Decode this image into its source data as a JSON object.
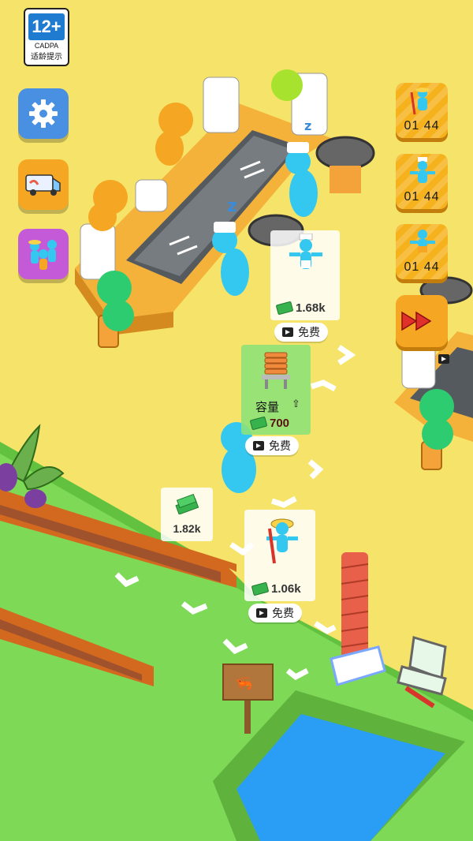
{
  "age_rating": {
    "badge": "12+",
    "org": "CADPA",
    "label": "适龄提示"
  },
  "hud": {
    "settings_icon": "gear-icon",
    "delivery_icon": "van-icon",
    "staff_icon": "workers-icon",
    "speedup_icon": "fast-forward-icon"
  },
  "worker_timers": [
    {
      "role": "fisher",
      "time": "01  44"
    },
    {
      "role": "chef",
      "time": "01  44"
    },
    {
      "role": "helper",
      "time": "01  44"
    }
  ],
  "upgrades": {
    "hire_chef": {
      "price": "1.68k",
      "free_label": "免费"
    },
    "capacity": {
      "label": "容量",
      "price": "700",
      "free_label": "免费"
    },
    "cash_pickup": {
      "price": "1.82k"
    },
    "hire_fisher": {
      "price": "1.06k",
      "free_label": "免费"
    }
  },
  "colors": {
    "ground": "#f6e46a",
    "grass": "#7ed957",
    "counter": "#f4b23a",
    "grill": "#555a5f",
    "water": "#2a9df4",
    "button_blue": "#4a90e2",
    "button_orange": "#f5a623",
    "button_purple": "#c45ad8",
    "worker_cyan": "#34c8f0",
    "customer_orange": "#f5a623",
    "customer_green": "#2ecc71",
    "customer_lime": "#a6e22e"
  }
}
